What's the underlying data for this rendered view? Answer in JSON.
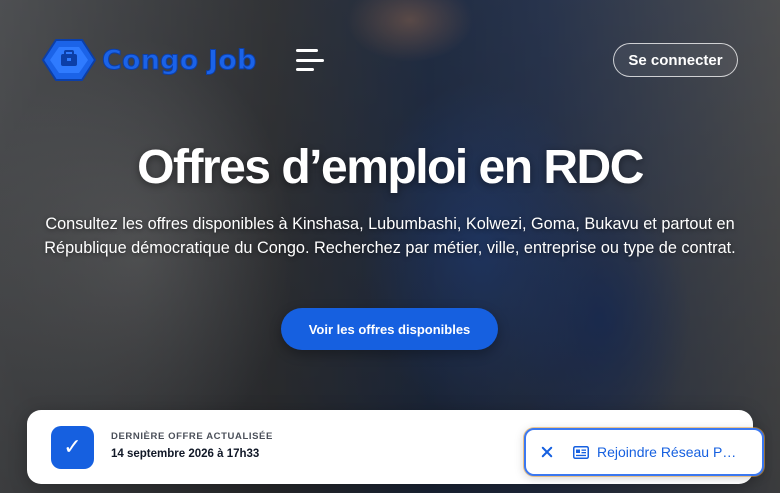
{
  "brand": {
    "name": "Congo Job",
    "color": "#1b63e8"
  },
  "header": {
    "menu_icon": "menu-icon",
    "login_label": "Se connecter"
  },
  "hero": {
    "title": "Offres d’emploi en RDC",
    "subtitle": "Consultez les offres disponibles à Kinshasa, Lubumbashi, Kolwezi, Goma, Bukavu et partout en République démocratique du Congo. Recherchez par métier, ville, entreprise ou type de contrat.",
    "cta_label": "Voir les offres disponibles"
  },
  "update_card": {
    "icon": "check-icon",
    "label": "DERNIÈRE OFFRE ACTUALISÉE",
    "date": "14 septembre 2026 à 17h33"
  },
  "join_banner": {
    "close_icon": "close-icon",
    "icon": "newspaper-icon",
    "label": "Rejoindre Réseau P…"
  },
  "colors": {
    "accent": "#1660e0",
    "card_bg": "#ffffff"
  }
}
